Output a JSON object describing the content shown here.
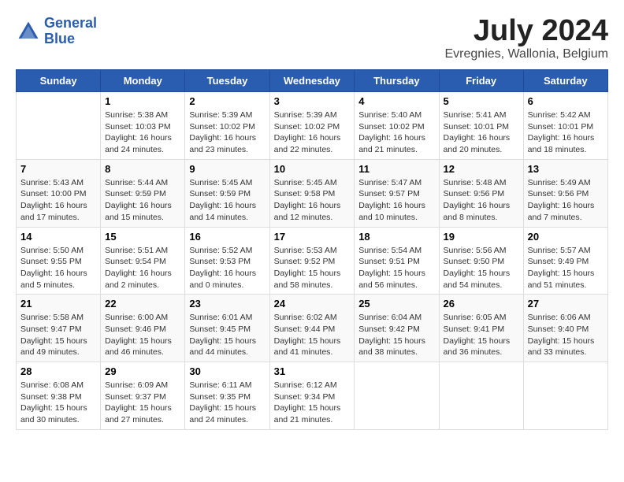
{
  "header": {
    "logo_line1": "General",
    "logo_line2": "Blue",
    "month_year": "July 2024",
    "location": "Evregnies, Wallonia, Belgium"
  },
  "days_of_week": [
    "Sunday",
    "Monday",
    "Tuesday",
    "Wednesday",
    "Thursday",
    "Friday",
    "Saturday"
  ],
  "weeks": [
    [
      {
        "day": "",
        "info": ""
      },
      {
        "day": "1",
        "info": "Sunrise: 5:38 AM\nSunset: 10:03 PM\nDaylight: 16 hours\nand 24 minutes."
      },
      {
        "day": "2",
        "info": "Sunrise: 5:39 AM\nSunset: 10:02 PM\nDaylight: 16 hours\nand 23 minutes."
      },
      {
        "day": "3",
        "info": "Sunrise: 5:39 AM\nSunset: 10:02 PM\nDaylight: 16 hours\nand 22 minutes."
      },
      {
        "day": "4",
        "info": "Sunrise: 5:40 AM\nSunset: 10:02 PM\nDaylight: 16 hours\nand 21 minutes."
      },
      {
        "day": "5",
        "info": "Sunrise: 5:41 AM\nSunset: 10:01 PM\nDaylight: 16 hours\nand 20 minutes."
      },
      {
        "day": "6",
        "info": "Sunrise: 5:42 AM\nSunset: 10:01 PM\nDaylight: 16 hours\nand 18 minutes."
      }
    ],
    [
      {
        "day": "7",
        "info": "Sunrise: 5:43 AM\nSunset: 10:00 PM\nDaylight: 16 hours\nand 17 minutes."
      },
      {
        "day": "8",
        "info": "Sunrise: 5:44 AM\nSunset: 9:59 PM\nDaylight: 16 hours\nand 15 minutes."
      },
      {
        "day": "9",
        "info": "Sunrise: 5:45 AM\nSunset: 9:59 PM\nDaylight: 16 hours\nand 14 minutes."
      },
      {
        "day": "10",
        "info": "Sunrise: 5:45 AM\nSunset: 9:58 PM\nDaylight: 16 hours\nand 12 minutes."
      },
      {
        "day": "11",
        "info": "Sunrise: 5:47 AM\nSunset: 9:57 PM\nDaylight: 16 hours\nand 10 minutes."
      },
      {
        "day": "12",
        "info": "Sunrise: 5:48 AM\nSunset: 9:56 PM\nDaylight: 16 hours\nand 8 minutes."
      },
      {
        "day": "13",
        "info": "Sunrise: 5:49 AM\nSunset: 9:56 PM\nDaylight: 16 hours\nand 7 minutes."
      }
    ],
    [
      {
        "day": "14",
        "info": "Sunrise: 5:50 AM\nSunset: 9:55 PM\nDaylight: 16 hours\nand 5 minutes."
      },
      {
        "day": "15",
        "info": "Sunrise: 5:51 AM\nSunset: 9:54 PM\nDaylight: 16 hours\nand 2 minutes."
      },
      {
        "day": "16",
        "info": "Sunrise: 5:52 AM\nSunset: 9:53 PM\nDaylight: 16 hours\nand 0 minutes."
      },
      {
        "day": "17",
        "info": "Sunrise: 5:53 AM\nSunset: 9:52 PM\nDaylight: 15 hours\nand 58 minutes."
      },
      {
        "day": "18",
        "info": "Sunrise: 5:54 AM\nSunset: 9:51 PM\nDaylight: 15 hours\nand 56 minutes."
      },
      {
        "day": "19",
        "info": "Sunrise: 5:56 AM\nSunset: 9:50 PM\nDaylight: 15 hours\nand 54 minutes."
      },
      {
        "day": "20",
        "info": "Sunrise: 5:57 AM\nSunset: 9:49 PM\nDaylight: 15 hours\nand 51 minutes."
      }
    ],
    [
      {
        "day": "21",
        "info": "Sunrise: 5:58 AM\nSunset: 9:47 PM\nDaylight: 15 hours\nand 49 minutes."
      },
      {
        "day": "22",
        "info": "Sunrise: 6:00 AM\nSunset: 9:46 PM\nDaylight: 15 hours\nand 46 minutes."
      },
      {
        "day": "23",
        "info": "Sunrise: 6:01 AM\nSunset: 9:45 PM\nDaylight: 15 hours\nand 44 minutes."
      },
      {
        "day": "24",
        "info": "Sunrise: 6:02 AM\nSunset: 9:44 PM\nDaylight: 15 hours\nand 41 minutes."
      },
      {
        "day": "25",
        "info": "Sunrise: 6:04 AM\nSunset: 9:42 PM\nDaylight: 15 hours\nand 38 minutes."
      },
      {
        "day": "26",
        "info": "Sunrise: 6:05 AM\nSunset: 9:41 PM\nDaylight: 15 hours\nand 36 minutes."
      },
      {
        "day": "27",
        "info": "Sunrise: 6:06 AM\nSunset: 9:40 PM\nDaylight: 15 hours\nand 33 minutes."
      }
    ],
    [
      {
        "day": "28",
        "info": "Sunrise: 6:08 AM\nSunset: 9:38 PM\nDaylight: 15 hours\nand 30 minutes."
      },
      {
        "day": "29",
        "info": "Sunrise: 6:09 AM\nSunset: 9:37 PM\nDaylight: 15 hours\nand 27 minutes."
      },
      {
        "day": "30",
        "info": "Sunrise: 6:11 AM\nSunset: 9:35 PM\nDaylight: 15 hours\nand 24 minutes."
      },
      {
        "day": "31",
        "info": "Sunrise: 6:12 AM\nSunset: 9:34 PM\nDaylight: 15 hours\nand 21 minutes."
      },
      {
        "day": "",
        "info": ""
      },
      {
        "day": "",
        "info": ""
      },
      {
        "day": "",
        "info": ""
      }
    ]
  ]
}
